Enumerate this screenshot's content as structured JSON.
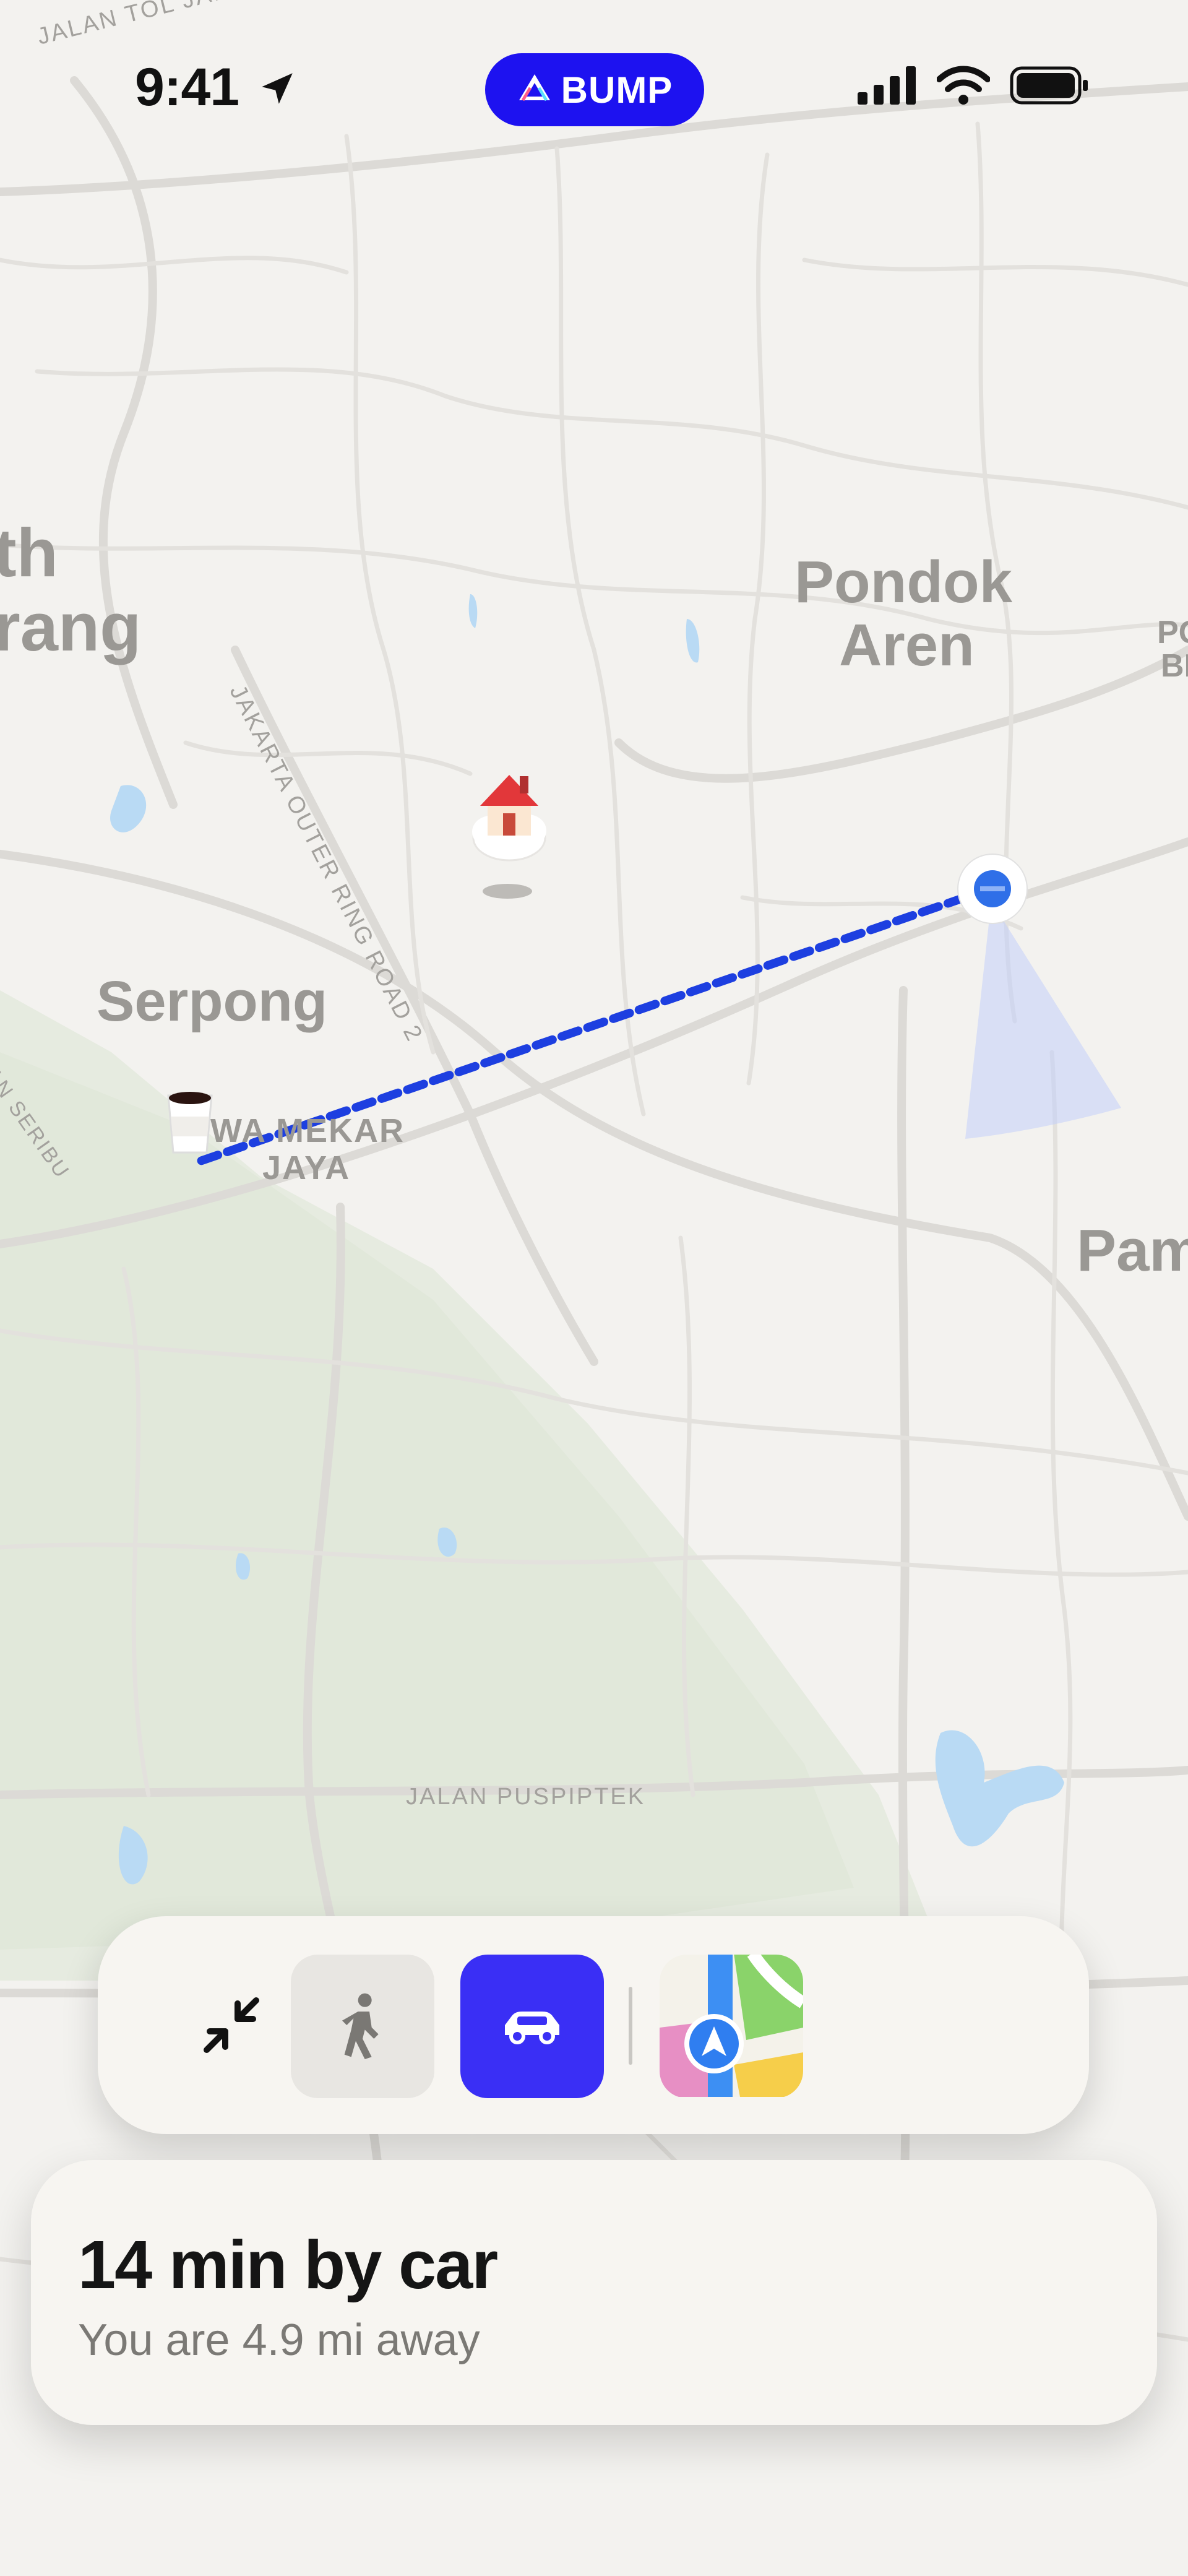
{
  "status_bar": {
    "time": "9:41",
    "icons": [
      "location-arrow-icon",
      "signal-bars-icon",
      "wifi-icon",
      "battery-icon"
    ]
  },
  "app_badge": {
    "label": "BUMP",
    "color": "#1d12f0"
  },
  "map": {
    "place_labels": {
      "north": "th",
      "north_2": "rang",
      "pondok": "Pondok",
      "aren": "Aren",
      "serpong": "Serpong",
      "mekar": "WA MEKAR",
      "jaya": "JAYA",
      "pam": "Pam",
      "po": "PO",
      "bi": "BI"
    },
    "road_labels": {
      "toll": "JALAN TOL JAKARTA–M",
      "ring_road": "JAKARTA OUTER RING ROAD 2",
      "puspiptek": "JALAN PUSPIPTEK",
      "seribu": "WAN SERIBU"
    },
    "markers": [
      "house-cloud-icon",
      "coffee-cup-icon",
      "user-location-dot"
    ],
    "route_color": "#1d3fe0"
  },
  "toolbar": {
    "buttons": [
      "collapse-icon",
      "walk-icon",
      "car-icon",
      "apple-maps-icon"
    ],
    "active_color": "#3a2ff5"
  },
  "info": {
    "eta": "14 min by car",
    "distance": "You are 4.9 mi away"
  }
}
